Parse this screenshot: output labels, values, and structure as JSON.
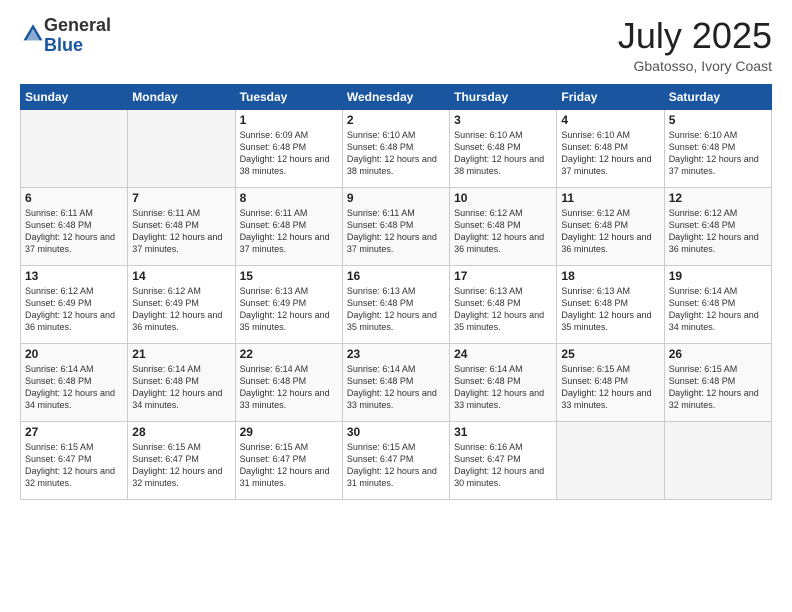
{
  "header": {
    "logo_general": "General",
    "logo_blue": "Blue",
    "title": "July 2025",
    "location": "Gbatosso, Ivory Coast"
  },
  "calendar": {
    "days_of_week": [
      "Sunday",
      "Monday",
      "Tuesday",
      "Wednesday",
      "Thursday",
      "Friday",
      "Saturday"
    ],
    "weeks": [
      {
        "days": [
          {
            "number": "",
            "info": "",
            "empty": true
          },
          {
            "number": "",
            "info": "",
            "empty": true
          },
          {
            "number": "1",
            "info": "Sunrise: 6:09 AM\nSunset: 6:48 PM\nDaylight: 12 hours and 38 minutes.",
            "empty": false
          },
          {
            "number": "2",
            "info": "Sunrise: 6:10 AM\nSunset: 6:48 PM\nDaylight: 12 hours and 38 minutes.",
            "empty": false
          },
          {
            "number": "3",
            "info": "Sunrise: 6:10 AM\nSunset: 6:48 PM\nDaylight: 12 hours and 38 minutes.",
            "empty": false
          },
          {
            "number": "4",
            "info": "Sunrise: 6:10 AM\nSunset: 6:48 PM\nDaylight: 12 hours and 37 minutes.",
            "empty": false
          },
          {
            "number": "5",
            "info": "Sunrise: 6:10 AM\nSunset: 6:48 PM\nDaylight: 12 hours and 37 minutes.",
            "empty": false
          }
        ]
      },
      {
        "days": [
          {
            "number": "6",
            "info": "Sunrise: 6:11 AM\nSunset: 6:48 PM\nDaylight: 12 hours and 37 minutes.",
            "empty": false
          },
          {
            "number": "7",
            "info": "Sunrise: 6:11 AM\nSunset: 6:48 PM\nDaylight: 12 hours and 37 minutes.",
            "empty": false
          },
          {
            "number": "8",
            "info": "Sunrise: 6:11 AM\nSunset: 6:48 PM\nDaylight: 12 hours and 37 minutes.",
            "empty": false
          },
          {
            "number": "9",
            "info": "Sunrise: 6:11 AM\nSunset: 6:48 PM\nDaylight: 12 hours and 37 minutes.",
            "empty": false
          },
          {
            "number": "10",
            "info": "Sunrise: 6:12 AM\nSunset: 6:48 PM\nDaylight: 12 hours and 36 minutes.",
            "empty": false
          },
          {
            "number": "11",
            "info": "Sunrise: 6:12 AM\nSunset: 6:48 PM\nDaylight: 12 hours and 36 minutes.",
            "empty": false
          },
          {
            "number": "12",
            "info": "Sunrise: 6:12 AM\nSunset: 6:48 PM\nDaylight: 12 hours and 36 minutes.",
            "empty": false
          }
        ]
      },
      {
        "days": [
          {
            "number": "13",
            "info": "Sunrise: 6:12 AM\nSunset: 6:49 PM\nDaylight: 12 hours and 36 minutes.",
            "empty": false
          },
          {
            "number": "14",
            "info": "Sunrise: 6:12 AM\nSunset: 6:49 PM\nDaylight: 12 hours and 36 minutes.",
            "empty": false
          },
          {
            "number": "15",
            "info": "Sunrise: 6:13 AM\nSunset: 6:49 PM\nDaylight: 12 hours and 35 minutes.",
            "empty": false
          },
          {
            "number": "16",
            "info": "Sunrise: 6:13 AM\nSunset: 6:48 PM\nDaylight: 12 hours and 35 minutes.",
            "empty": false
          },
          {
            "number": "17",
            "info": "Sunrise: 6:13 AM\nSunset: 6:48 PM\nDaylight: 12 hours and 35 minutes.",
            "empty": false
          },
          {
            "number": "18",
            "info": "Sunrise: 6:13 AM\nSunset: 6:48 PM\nDaylight: 12 hours and 35 minutes.",
            "empty": false
          },
          {
            "number": "19",
            "info": "Sunrise: 6:14 AM\nSunset: 6:48 PM\nDaylight: 12 hours and 34 minutes.",
            "empty": false
          }
        ]
      },
      {
        "days": [
          {
            "number": "20",
            "info": "Sunrise: 6:14 AM\nSunset: 6:48 PM\nDaylight: 12 hours and 34 minutes.",
            "empty": false
          },
          {
            "number": "21",
            "info": "Sunrise: 6:14 AM\nSunset: 6:48 PM\nDaylight: 12 hours and 34 minutes.",
            "empty": false
          },
          {
            "number": "22",
            "info": "Sunrise: 6:14 AM\nSunset: 6:48 PM\nDaylight: 12 hours and 33 minutes.",
            "empty": false
          },
          {
            "number": "23",
            "info": "Sunrise: 6:14 AM\nSunset: 6:48 PM\nDaylight: 12 hours and 33 minutes.",
            "empty": false
          },
          {
            "number": "24",
            "info": "Sunrise: 6:14 AM\nSunset: 6:48 PM\nDaylight: 12 hours and 33 minutes.",
            "empty": false
          },
          {
            "number": "25",
            "info": "Sunrise: 6:15 AM\nSunset: 6:48 PM\nDaylight: 12 hours and 33 minutes.",
            "empty": false
          },
          {
            "number": "26",
            "info": "Sunrise: 6:15 AM\nSunset: 6:48 PM\nDaylight: 12 hours and 32 minutes.",
            "empty": false
          }
        ]
      },
      {
        "days": [
          {
            "number": "27",
            "info": "Sunrise: 6:15 AM\nSunset: 6:47 PM\nDaylight: 12 hours and 32 minutes.",
            "empty": false
          },
          {
            "number": "28",
            "info": "Sunrise: 6:15 AM\nSunset: 6:47 PM\nDaylight: 12 hours and 32 minutes.",
            "empty": false
          },
          {
            "number": "29",
            "info": "Sunrise: 6:15 AM\nSunset: 6:47 PM\nDaylight: 12 hours and 31 minutes.",
            "empty": false
          },
          {
            "number": "30",
            "info": "Sunrise: 6:15 AM\nSunset: 6:47 PM\nDaylight: 12 hours and 31 minutes.",
            "empty": false
          },
          {
            "number": "31",
            "info": "Sunrise: 6:16 AM\nSunset: 6:47 PM\nDaylight: 12 hours and 30 minutes.",
            "empty": false
          },
          {
            "number": "",
            "info": "",
            "empty": true
          },
          {
            "number": "",
            "info": "",
            "empty": true
          }
        ]
      }
    ]
  }
}
